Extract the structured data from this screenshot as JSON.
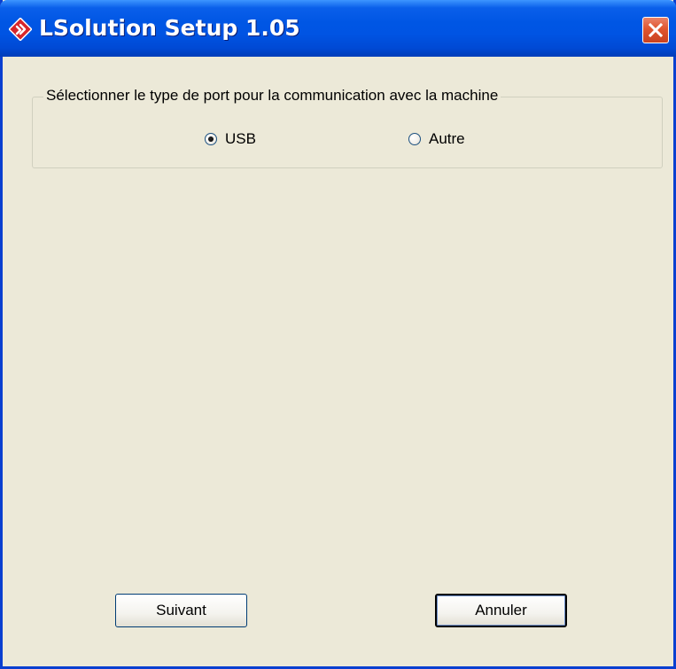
{
  "window": {
    "title": "LSolution Setup 1.05",
    "icon": "app-diamond-icon",
    "close_icon": "close-icon"
  },
  "port_group": {
    "legend": "Sélectionner le type de port pour la communication avec la machine",
    "options": [
      {
        "label": "USB",
        "selected": true
      },
      {
        "label": "Autre",
        "selected": false
      }
    ]
  },
  "buttons": {
    "next": "Suivant",
    "cancel": "Annuler"
  },
  "colors": {
    "titlebar": "#0054E3",
    "dialog_bg": "#ECE9D8",
    "close_button": "#E0552F",
    "icon_red": "#D7262B"
  }
}
